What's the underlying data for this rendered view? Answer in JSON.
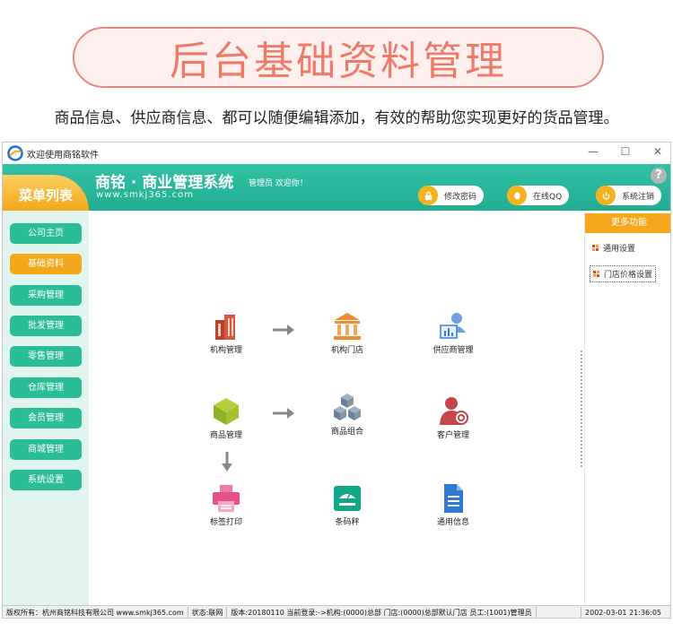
{
  "banner": {
    "title": "后台基础资料管理",
    "subtitle": "商品信息、供应商信息、都可以随便编辑添加，有效的帮助您实现更好的货品管理。"
  },
  "window": {
    "title": "欢迎使用商铭软件",
    "controls": [
      "—",
      "☐",
      "✕"
    ]
  },
  "header": {
    "menu_label": "菜单列表",
    "system_title": "商铭 · 商业管理系统",
    "welcome": "管理员 欢迎你！",
    "url": "www.smkj365.com",
    "buttons": [
      {
        "label": "修改密码",
        "icon": "lock-icon"
      },
      {
        "label": "在线QQ",
        "icon": "qq-icon"
      },
      {
        "label": "系统注销",
        "icon": "power-icon"
      }
    ],
    "help": "?"
  },
  "sidebar": {
    "items": [
      {
        "label": "公司主页",
        "active": false
      },
      {
        "label": "基础资料",
        "active": true
      },
      {
        "label": "采购管理",
        "active": false
      },
      {
        "label": "批发管理",
        "active": false
      },
      {
        "label": "零售管理",
        "active": false
      },
      {
        "label": "仓库管理",
        "active": false
      },
      {
        "label": "会员管理",
        "active": false
      },
      {
        "label": "商城管理",
        "active": false
      },
      {
        "label": "系统设置",
        "active": false
      }
    ]
  },
  "right_panel": {
    "header": "更多功能",
    "links": [
      "通用设置",
      "门店价格设置"
    ]
  },
  "workspace": {
    "nodes": [
      {
        "label": "机构管理",
        "icon": "building-icon"
      },
      {
        "label": "机构门店",
        "icon": "bank-icon"
      },
      {
        "label": "供应商管理",
        "icon": "supplier-icon"
      },
      {
        "label": "商品管理",
        "icon": "product-cube-icon"
      },
      {
        "label": "商品组合",
        "icon": "cubes-icon"
      },
      {
        "label": "客户管理",
        "icon": "customer-gear-icon"
      },
      {
        "label": "标签打印",
        "icon": "printer-icon"
      },
      {
        "label": "条码秤",
        "icon": "scale-icon"
      },
      {
        "label": "通用信息",
        "icon": "document-icon"
      }
    ]
  },
  "statusbar": {
    "copyright": "版权所有：杭州商铭科技有限公司 www.smkj365.com",
    "status": "状态:联网",
    "version": "版本:20180110 当前登录:->机构:(0000)总部 门店:(0000)总部默认门店 员工:(1001)管理员",
    "datetime": "2002-03-01 21:36:05"
  },
  "colors": {
    "banner_accent": "#ee7b6a",
    "header_green": "#2bb596",
    "menu_orange": "#f3a81b",
    "sidebar_bg": "#e2f4ef"
  }
}
